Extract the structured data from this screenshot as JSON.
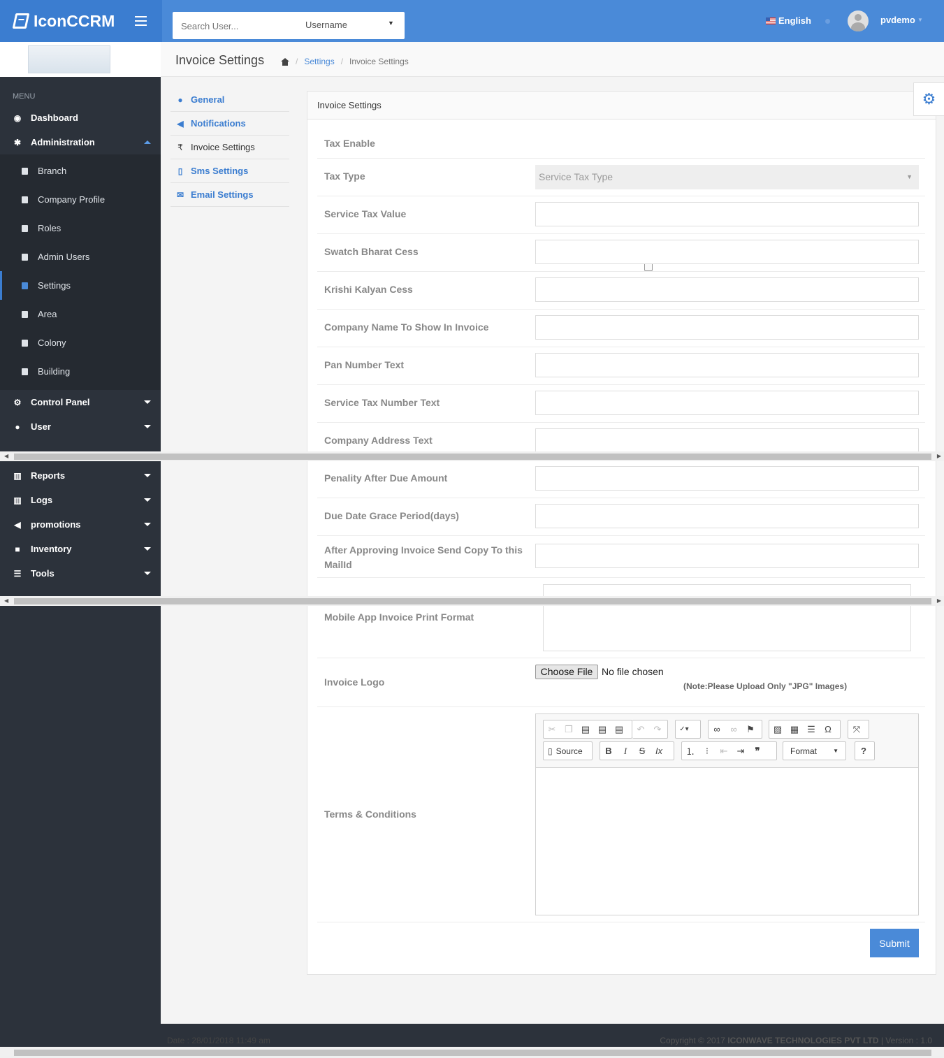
{
  "app": {
    "name": "IconCCRM"
  },
  "search": {
    "placeholder": "Search User...",
    "filter": "Username"
  },
  "header": {
    "language": "English",
    "username": "pvdemo"
  },
  "page": {
    "title": "Invoice Settings",
    "breadcrumb": [
      "Settings",
      "Invoice Settings"
    ]
  },
  "sidebar": {
    "menu_title": "MENU",
    "top": [
      {
        "label": "Dashboard",
        "icon": "dashboard-icon"
      },
      {
        "label": "Administration",
        "icon": "gear-icon"
      }
    ],
    "admin_items": [
      "Branch",
      "Company Profile",
      "Roles",
      "Admin Users",
      "Settings",
      "Area",
      "Colony",
      "Building"
    ],
    "active_item": "Settings",
    "bottom": [
      {
        "label": "Control Panel",
        "icon": "cogs-icon"
      },
      {
        "label": "User",
        "icon": "user-icon"
      },
      {
        "label": "Reports",
        "icon": "bar-chart-icon"
      },
      {
        "label": "Logs",
        "icon": "bar-chart-icon"
      },
      {
        "label": "promotions",
        "icon": "bullhorn-icon"
      },
      {
        "label": "Inventory",
        "icon": "truck-icon"
      },
      {
        "label": "Tools",
        "icon": "list-icon"
      }
    ]
  },
  "settings_nav": [
    {
      "label": "General",
      "icon": "user-icon"
    },
    {
      "label": "Notifications",
      "icon": "bullhorn-icon"
    },
    {
      "label": "Invoice Settings",
      "icon": "rupee-icon"
    },
    {
      "label": "Sms Settings",
      "icon": "mobile-icon"
    },
    {
      "label": "Email Settings",
      "icon": "envelope-icon"
    }
  ],
  "form": {
    "panel_title": "Invoice Settings",
    "tax_enable": {
      "label": "Tax Enable",
      "checked": false
    },
    "tax_type": {
      "label": "Tax Type",
      "placeholder": "Service Tax Type"
    },
    "fields": [
      "Service Tax Value",
      "Swatch Bharat Cess",
      "Krishi Kalyan Cess",
      "Company Name To Show In Invoice",
      "Pan Number Text",
      "Service Tax Number Text",
      "Company Address Text",
      "Penality After Due Amount",
      "Due Date Grace Period(days)",
      "After Approving Invoice Send Copy To this MailId"
    ],
    "print_format_label": "Mobile App Invoice Print Format",
    "logo": {
      "label": "Invoice Logo",
      "button": "Choose File",
      "status": "No file chosen",
      "note": "(Note:Please Upload Only \"JPG\" Images)"
    },
    "terms": {
      "label": "Terms & Conditions",
      "source_label": "Source",
      "format_label": "Format"
    },
    "submit": "Submit"
  },
  "footer": {
    "date": "Date : 28/01/2018 11:49 am",
    "copyright": "Copyright © 2017 ",
    "company": "ICONWAVE TECHNOLOGIES PVT LTD",
    "version": " | Version : 1.0"
  },
  "colors": {
    "brand": "#4a8ad8",
    "sidebar": "#2c323b",
    "submit": "#4a8ad8"
  }
}
